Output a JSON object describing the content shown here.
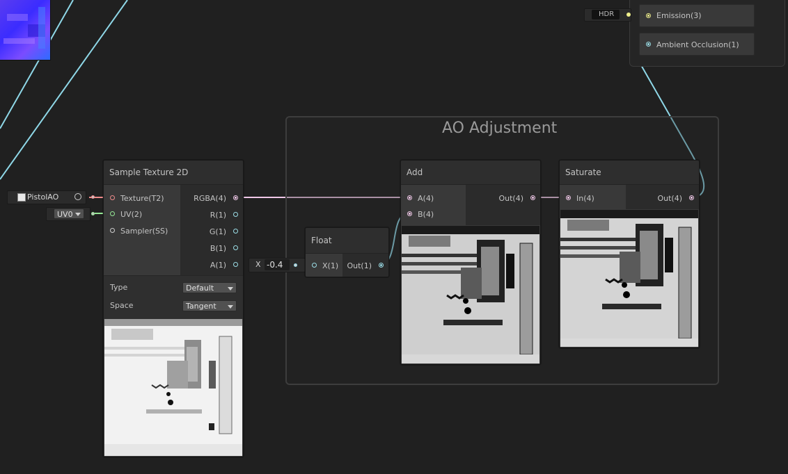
{
  "colors": {
    "canvas_bg": "#202020",
    "wire_texture": "#f08c8c",
    "wire_vector4": "#f0c8e8",
    "wire_vector1": "#8fd8e8",
    "wire_vector2": "#96e896",
    "wire_vector3": "#f0f08c"
  },
  "master": {
    "hdr_label": "HDR",
    "emission_label": "Emission(3)",
    "ambient_occlusion_label": "Ambient Occlusion(1)"
  },
  "group": {
    "title": "AO Adjustment"
  },
  "sample_texture": {
    "title": "Sample Texture 2D",
    "inputs": [
      "Texture(T2)",
      "UV(2)",
      "Sampler(SS)"
    ],
    "outputs": [
      "RGBA(4)",
      "R(1)",
      "G(1)",
      "B(1)",
      "A(1)"
    ],
    "texture_field": "PistolAO",
    "uv_dropdown": "UV0",
    "type_label": "Type",
    "type_value": "Default",
    "space_label": "Space",
    "space_value": "Tangent"
  },
  "float_node": {
    "title": "Float",
    "input": "X(1)",
    "output": "Out(1)",
    "x_label": "X",
    "x_value": "-0.4"
  },
  "add_node": {
    "title": "Add",
    "inputs": [
      "A(4)",
      "B(4)"
    ],
    "output": "Out(4)"
  },
  "saturate_node": {
    "title": "Saturate",
    "input": "In(4)",
    "output": "Out(4)"
  },
  "icons": [
    "texture-icon",
    "object-picker-icon",
    "dropdown-caret-icon"
  ]
}
